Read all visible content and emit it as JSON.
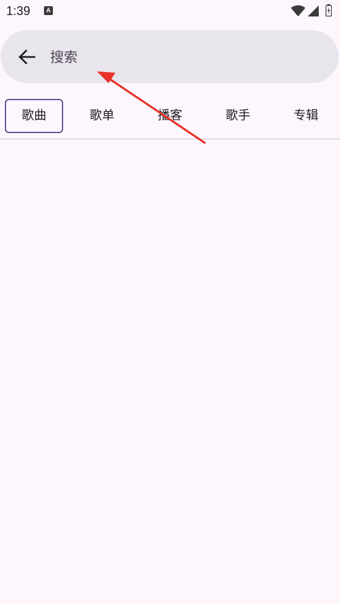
{
  "status_bar": {
    "time": "1:39",
    "notification_letter": "A",
    "icons": [
      "wifi-icon",
      "signal-icon",
      "battery-icon"
    ]
  },
  "search": {
    "placeholder": "搜索",
    "value": "",
    "back_icon": "back-arrow-icon"
  },
  "tabs": [
    {
      "label": "歌曲",
      "active": true
    },
    {
      "label": "歌单",
      "active": false
    },
    {
      "label": "播客",
      "active": false
    },
    {
      "label": "歌手",
      "active": false
    },
    {
      "label": "专辑",
      "active": false
    }
  ],
  "colors": {
    "background": "#fdf7fd",
    "search_bar": "#e9e5ed",
    "active_tab_border": "#6e5a98",
    "annotation_arrow": "#e8312a"
  }
}
